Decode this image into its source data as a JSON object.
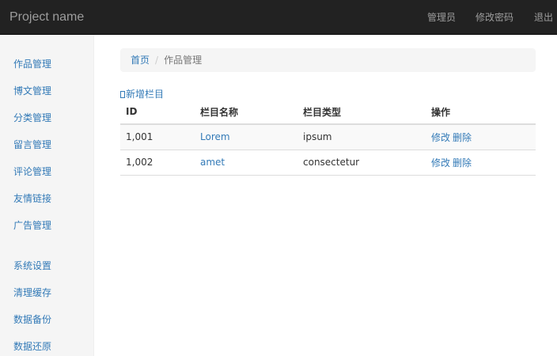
{
  "navbar": {
    "brand": "Project name",
    "links": {
      "admin": "管理员",
      "change_password": "修改密码",
      "logout": "退出"
    }
  },
  "sidebar": {
    "items": [
      {
        "label": "作品管理"
      },
      {
        "label": "博文管理"
      },
      {
        "label": "分类管理"
      },
      {
        "label": "留言管理"
      },
      {
        "label": "评论管理"
      },
      {
        "label": "友情链接"
      },
      {
        "label": "广告管理"
      },
      {
        "label": "系统设置"
      },
      {
        "label": "清理缓存"
      },
      {
        "label": "数据备份"
      },
      {
        "label": "数据还原"
      }
    ]
  },
  "breadcrumb": {
    "home": "首页",
    "separator": "/",
    "current": "作品管理"
  },
  "actions": {
    "add_column": "新增栏目"
  },
  "table": {
    "headers": [
      "ID",
      "栏目名称",
      "栏目类型",
      "操作"
    ],
    "rows": [
      {
        "id": "1,001",
        "name": "Lorem",
        "type": "ipsum",
        "edit": "修改",
        "delete": "删除"
      },
      {
        "id": "1,002",
        "name": "amet",
        "type": "consectetur",
        "edit": "修改",
        "delete": "删除"
      }
    ]
  },
  "colors": {
    "navbar_bg": "#222222",
    "navbar_text": "#9d9d9d",
    "link": "#337ab7",
    "sidebar_bg": "#f5f5f5"
  }
}
